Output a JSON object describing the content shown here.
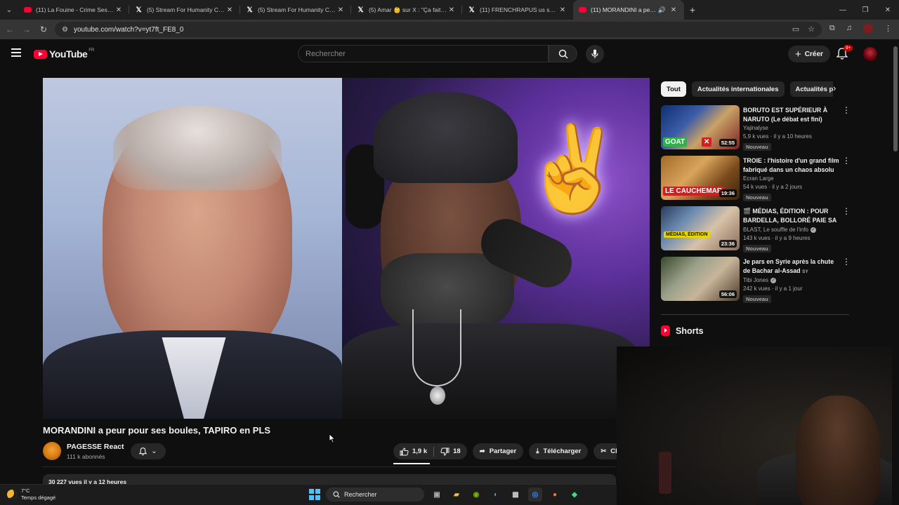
{
  "browser": {
    "tabs": [
      {
        "title": "(11) La Fouine - Crime Session -",
        "icon": "youtube-icon",
        "active": false
      },
      {
        "title": "(5) Stream For Humanity Clips sur",
        "icon": "x-icon",
        "active": false
      },
      {
        "title": "(5) Stream For Humanity Clips s",
        "icon": "x-icon",
        "active": false
      },
      {
        "title": "(5) Amar 👶 sur X : \"Ça fait des",
        "icon": "x-icon",
        "active": false
      },
      {
        "title": "(11) FRENCHRAPUS us sur X : \"",
        "icon": "x-icon",
        "active": false
      },
      {
        "title": "(11) MORANDINI a peur pou",
        "icon": "youtube-icon",
        "active": true
      }
    ],
    "url": "youtube.com/watch?v=yt7ft_FE8_0"
  },
  "masthead": {
    "logo_text": "YouTube",
    "country": "FR",
    "search_placeholder": "Rechercher",
    "create_label": "Créer",
    "notif_count": "9+"
  },
  "video": {
    "title": "MORANDINI a peur pour ses boules, TAPIRO en PLS",
    "channel": "PAGESSE React",
    "subscribers": "111 k abonnés",
    "likes": "1,9 k",
    "dislikes": "18",
    "share_label": "Partager",
    "download_label": "Télécharger",
    "clip_label": "Cl",
    "description_meta": "30 227 vues  il y a 12 heures"
  },
  "sidebar": {
    "chips": [
      "Tout",
      "Actualités internationales",
      "Actualités po"
    ],
    "recommendations": [
      {
        "title": "BORUTO EST SUPÉRIEUR À NARUTO (Le débat est fini)",
        "channel": "Yajinalyse",
        "verified": false,
        "meta": "5,9 k vues · il y a 10 heures",
        "badge": "Nouveau",
        "duration": "52:55",
        "thumb_text": "GOAT"
      },
      {
        "title": "TROIE : l'histoire d'un grand film fabriqué dans un chaos absolu",
        "channel": "Ecran Large",
        "verified": false,
        "meta": "54 k vues · il y a 2 jours",
        "badge": "Nouveau",
        "duration": "19:36",
        "thumb_text": "LE CAUCHEMAR"
      },
      {
        "title": "🎬 MÉDIAS, ÉDITION : POUR BARDELLA, BOLLORÉ PAIE SA ...",
        "channel": "BLAST, Le souffle de l'info",
        "verified": true,
        "meta": "143 k vues · il y a 9 heures",
        "badge": "Nouveau",
        "duration": "23:36",
        "thumb_text": "MÉDIAS, ÉDITION"
      },
      {
        "title": "Je pars en Syrie après la chute de Bachar al-Assad",
        "channel": "Tibi Jones",
        "verified": true,
        "meta": "242 k vues · il y a 1 jour",
        "badge": "Nouveau",
        "duration": "56:06",
        "thumb_text": "",
        "title_suffix": "SY"
      }
    ],
    "shorts_label": "Shorts"
  },
  "taskbar": {
    "temperature": "7°C",
    "weather": "Temps dégagé",
    "search_label": "Rechercher"
  },
  "colors": {
    "background": "#0f0f0f",
    "youtube_red": "#ff0033",
    "chip_bg": "#272727"
  }
}
